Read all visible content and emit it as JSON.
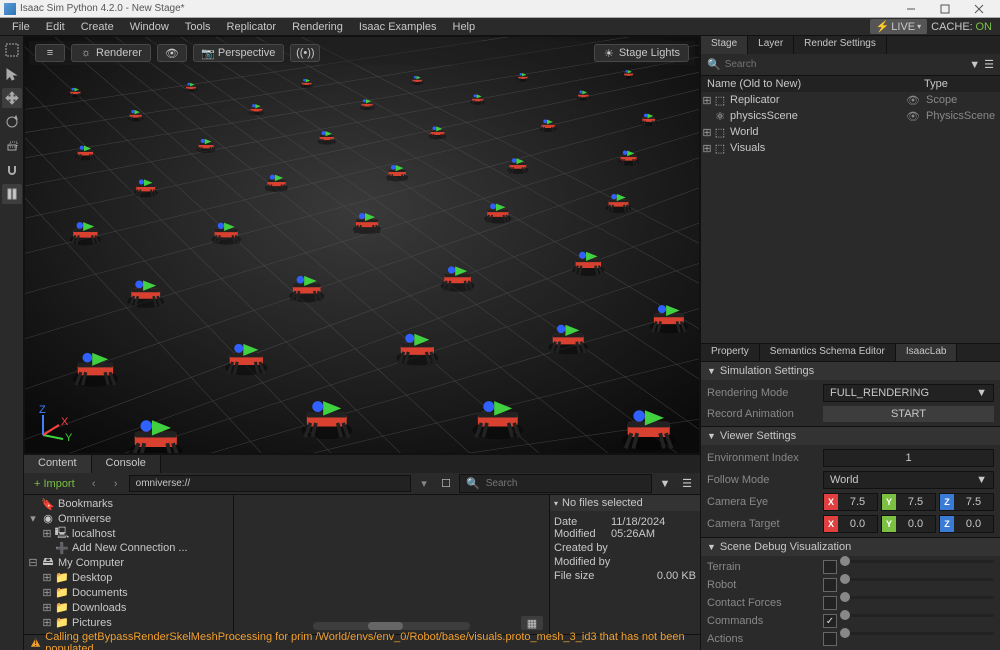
{
  "window_title": "Isaac Sim Python 4.2.0 - New Stage*",
  "menubar": [
    "File",
    "Edit",
    "Create",
    "Window",
    "Tools",
    "Replicator",
    "Rendering",
    "Isaac Examples",
    "Help"
  ],
  "live_label": "LIVE",
  "cache_label": "CACHE:",
  "cache_state": "ON",
  "vp": {
    "renderer": "Renderer",
    "camera": "Perspective",
    "lights": "Stage Lights"
  },
  "bottom_tabs": [
    "Content",
    "Console"
  ],
  "import_label": "+ Import",
  "path_field": "omniverse://",
  "search_placeholder": "Search",
  "browser_tree": [
    {
      "depth": 0,
      "arrow": "",
      "icon": "bookmark",
      "label": "Bookmarks"
    },
    {
      "depth": 0,
      "arrow": "▾",
      "icon": "omni",
      "label": "Omniverse"
    },
    {
      "depth": 1,
      "arrow": "⊞",
      "icon": "host",
      "label": "localhost"
    },
    {
      "depth": 1,
      "arrow": "",
      "icon": "add",
      "label": "Add New Connection ..."
    },
    {
      "depth": 0,
      "arrow": "⊟",
      "icon": "drive",
      "label": "My Computer"
    },
    {
      "depth": 1,
      "arrow": "⊞",
      "icon": "folder",
      "label": "Desktop"
    },
    {
      "depth": 1,
      "arrow": "⊞",
      "icon": "folder",
      "label": "Documents"
    },
    {
      "depth": 1,
      "arrow": "⊞",
      "icon": "folder",
      "label": "Downloads"
    },
    {
      "depth": 1,
      "arrow": "⊞",
      "icon": "folder",
      "label": "Pictures"
    }
  ],
  "details": {
    "header": "No files selected",
    "rows": [
      {
        "k": "Date Modified",
        "v": "11/18/2024 05:26AM"
      },
      {
        "k": "Created by",
        "v": ""
      },
      {
        "k": "Modified by",
        "v": ""
      },
      {
        "k": "File size",
        "v": "0.00 KB"
      }
    ]
  },
  "status_warning": "Calling getBypassRenderSkelMeshProcessing for prim /World/envs/env_0/Robot/base/visuals.proto_mesh_3_id3 that has not been populated",
  "right_tabs_top": [
    "Stage",
    "Layer",
    "Render Settings"
  ],
  "right_tabs_top_active": 0,
  "stage_search_placeholder": "Search",
  "stage_cols": {
    "name": "Name (Old to New)",
    "type": "Type"
  },
  "stage_tree": [
    {
      "depth": 1,
      "arrow": "⊞",
      "icon": "xform",
      "label": "Replicator",
      "eye": true,
      "type": "Scope"
    },
    {
      "depth": 1,
      "arrow": "",
      "icon": "phys",
      "label": "physicsScene",
      "eye": true,
      "type": "PhysicsScene"
    },
    {
      "depth": 1,
      "arrow": "⊞",
      "icon": "xform",
      "label": "World",
      "eye": false,
      "type": ""
    },
    {
      "depth": 1,
      "arrow": "⊞",
      "icon": "xform",
      "label": "Visuals",
      "eye": false,
      "type": ""
    }
  ],
  "right_tabs_bottom": [
    "Property",
    "Semantics Schema Editor",
    "IsaacLab"
  ],
  "right_tabs_bottom_active": 2,
  "inspector": {
    "sections": {
      "sim": "Simulation Settings",
      "viewer": "Viewer Settings",
      "debug": "Scene Debug Visualization"
    },
    "rendering_mode": {
      "label": "Rendering Mode",
      "value": "FULL_RENDERING"
    },
    "record_anim": {
      "label": "Record Animation",
      "button": "START"
    },
    "env_index": {
      "label": "Environment Index",
      "value": "1"
    },
    "follow_mode": {
      "label": "Follow Mode",
      "value": "World"
    },
    "cam_eye": {
      "label": "Camera Eye",
      "x": "7.5",
      "y": "7.5",
      "z": "7.5"
    },
    "cam_target": {
      "label": "Camera Target",
      "x": "0.0",
      "y": "0.0",
      "z": "0.0"
    },
    "debug_items": [
      {
        "label": "Terrain",
        "checked": false
      },
      {
        "label": "Robot",
        "checked": false
      },
      {
        "label": "Contact Forces",
        "checked": false
      },
      {
        "label": "Commands",
        "checked": true
      },
      {
        "label": "Actions",
        "checked": false
      }
    ]
  }
}
